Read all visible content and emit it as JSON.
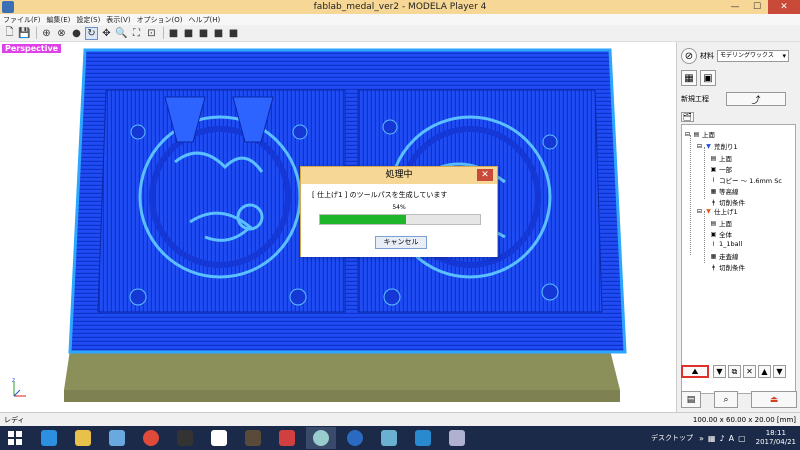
{
  "window": {
    "title": "fablab_medal_ver2 - MODELA Player 4",
    "min_label": "—",
    "max_label": "☐",
    "close_label": "✕"
  },
  "menu": [
    "ファイル(F)",
    "編集(E)",
    "設定(S)",
    "表示(V)",
    "オプション(O)",
    "ヘルプ(H)"
  ],
  "viewport": {
    "label": "Perspective",
    "axis_x": "x",
    "axis_y": "y",
    "axis_z": "z"
  },
  "dialog": {
    "title": "処理中",
    "message": "[ 仕上げ1 ] のツールパスを生成しています",
    "percent_text": "54%",
    "progress": 0.54,
    "cancel_label": "キャンセル",
    "close_label": "✕"
  },
  "panel": {
    "material_label": "材料",
    "material_value": "モデリングワックス",
    "new_process_label": "新規工程",
    "tree": [
      {
        "level": 0,
        "label": "上面"
      },
      {
        "level": 1,
        "label": "荒削り1"
      },
      {
        "level": 2,
        "label": "上面"
      },
      {
        "level": 2,
        "label": "一部"
      },
      {
        "level": 2,
        "label": "コピー ～ 1.6mm Sc"
      },
      {
        "level": 2,
        "label": "等高線"
      },
      {
        "level": 2,
        "label": "切削条件"
      },
      {
        "level": 1,
        "label": "仕上げ1"
      },
      {
        "level": 2,
        "label": "上面"
      },
      {
        "level": 2,
        "label": "全体"
      },
      {
        "level": 2,
        "label": "1_1ball"
      },
      {
        "level": 2,
        "label": "走査線"
      },
      {
        "level": 2,
        "label": "切削条件"
      }
    ]
  },
  "status": {
    "left": "レディ",
    "right": "100.00 x 60.00 x 20.00 [mm]"
  },
  "taskbar": {
    "desktop_label": "デスクトップ",
    "time": "18:11",
    "date": "2017/04/21"
  },
  "colors": {
    "model_blue": "#1a47f0",
    "base_olive": "#8b8f5a",
    "titlebar": "#f6d795",
    "progress_green": "#1fb52a",
    "highlight_red": "#e0302a"
  }
}
